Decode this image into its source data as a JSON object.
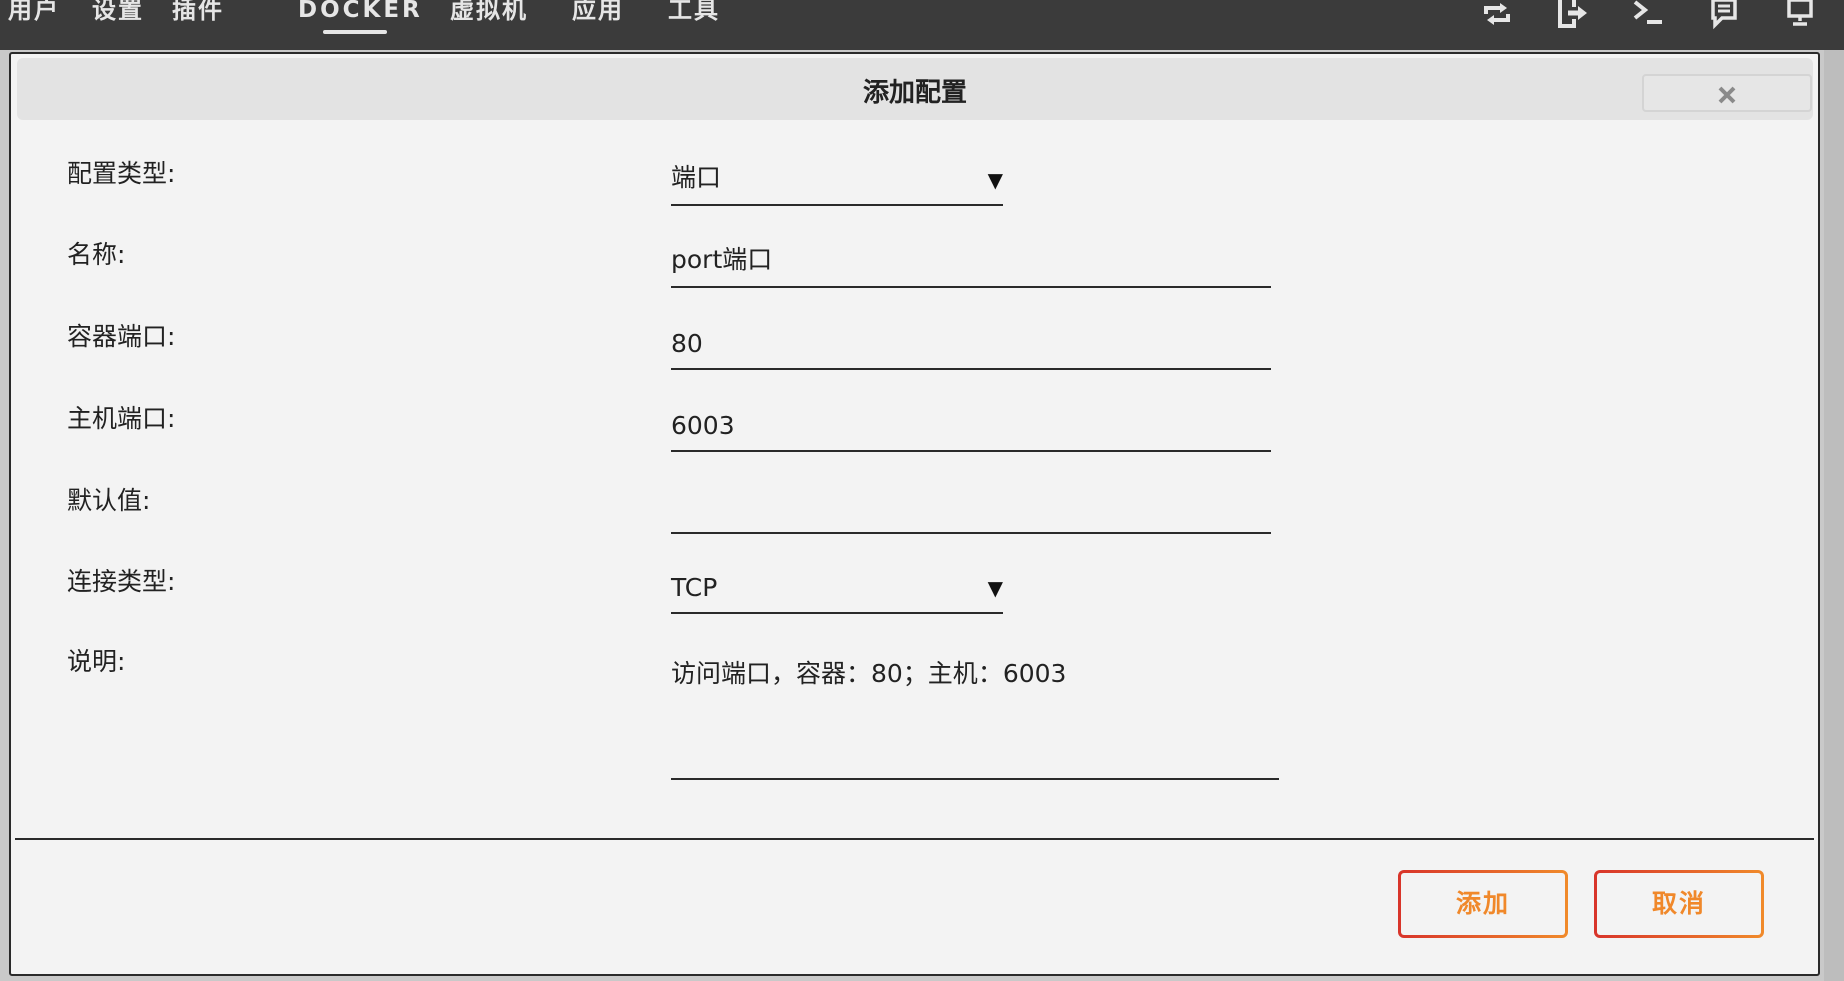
{
  "topnav": {
    "items": [
      "用户",
      "设置",
      "插件",
      "DOCKER",
      "虚拟机",
      "应用",
      "工具"
    ],
    "active": "DOCKER",
    "icons": [
      "refresh-icon",
      "logout-icon",
      "terminal-icon",
      "notes-icon",
      "monitor-icon"
    ]
  },
  "dialog": {
    "title": "添加配置",
    "close_icon": "close-icon",
    "fields": {
      "config_type": {
        "label": "配置类型:",
        "value": "端口"
      },
      "name": {
        "label": "名称:",
        "value": "port端口"
      },
      "container_port": {
        "label": "容器端口:",
        "value": "80"
      },
      "host_port": {
        "label": "主机端口:",
        "value": "6003"
      },
      "default_value": {
        "label": "默认值:",
        "value": ""
      },
      "connection_type": {
        "label": "连接类型:",
        "value": "TCP"
      },
      "description": {
        "label": "说明:",
        "value": "访问端口，容器：80；主机：6003"
      }
    },
    "buttons": {
      "add": "添加",
      "cancel": "取消"
    }
  },
  "colors": {
    "topbar_bg": "#3b3b3b",
    "dialog_bg": "#f3f3f3",
    "accent_gradient_start": "#d8342a",
    "accent_gradient_end": "#f08a2a",
    "button_text": "#f0882a"
  }
}
